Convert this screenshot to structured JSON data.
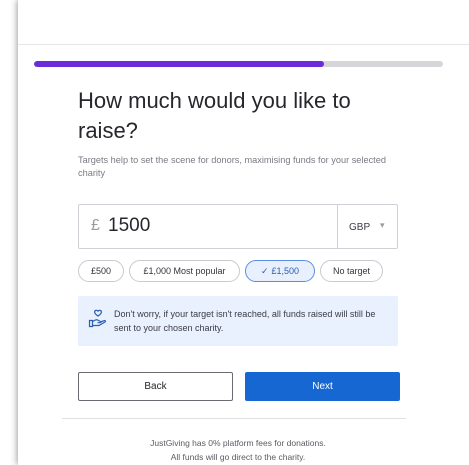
{
  "progress": {
    "fraction": 0.71
  },
  "heading": "How much would you like to raise?",
  "subtitle": "Targets help to set the scene for donors, maximising funds for your selected charity",
  "amount": {
    "currency_symbol": "£",
    "value": "1500"
  },
  "currency": {
    "selected": "GBP",
    "icon": "chevron-down-icon"
  },
  "presets": [
    {
      "label": "£500",
      "selected": false
    },
    {
      "label": "£1,000 Most popular",
      "selected": false
    },
    {
      "label": "£1,500",
      "selected": true,
      "icon": "check-icon"
    },
    {
      "label": "No target",
      "selected": false
    }
  ],
  "notice": {
    "icon": "hand-heart-icon",
    "text": "Don't worry, if your target isn't reached, all funds raised will still be sent to your chosen charity."
  },
  "buttons": {
    "back": "Back",
    "next": "Next"
  },
  "footer": {
    "line1": "JustGiving has 0% platform fees for donations.",
    "line2": "All funds will go direct to the charity."
  },
  "colors": {
    "progress": "#6c2bd9",
    "primary": "#1767d3",
    "notice_bg": "#e8f1fd"
  }
}
